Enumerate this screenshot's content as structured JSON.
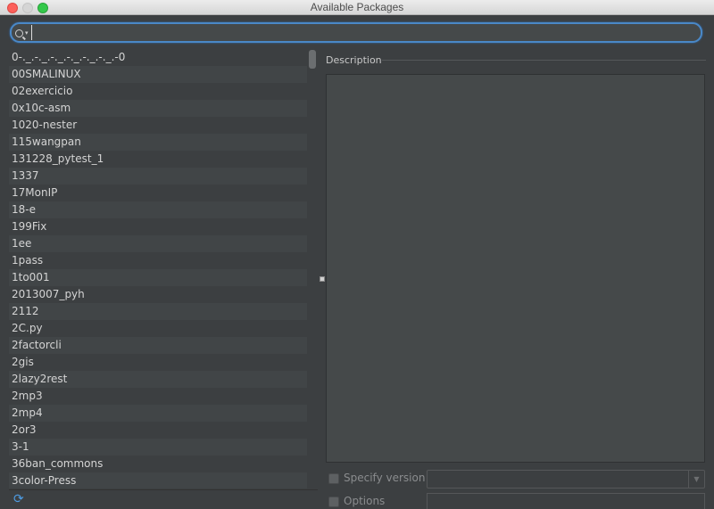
{
  "window": {
    "title": "Available Packages"
  },
  "search": {
    "value": "",
    "icon": "search-icon"
  },
  "packages": [
    "0-._.-._.-._.-._.-._.-._.-0",
    "00SMALINUX",
    "02exercicio",
    "0x10c-asm",
    "1020-nester",
    "115wangpan",
    "131228_pytest_1",
    "1337",
    "17MonIP",
    "18-e",
    "199Fix",
    "1ee",
    "1pass",
    "1to001",
    "2013007_pyh",
    "2112",
    "2C.py",
    "2factorcli",
    "2gis",
    "2lazy2rest",
    "2mp3",
    "2mp4",
    "2or3",
    "3-1",
    "36ban_commons",
    "3color-Press"
  ],
  "description": {
    "label": "Description",
    "content": ""
  },
  "options": {
    "specify_version_label": "Specify version",
    "specify_version_checked": false,
    "options_label": "Options",
    "options_checked": false
  },
  "footer": {
    "refresh_icon": "refresh-icon"
  }
}
